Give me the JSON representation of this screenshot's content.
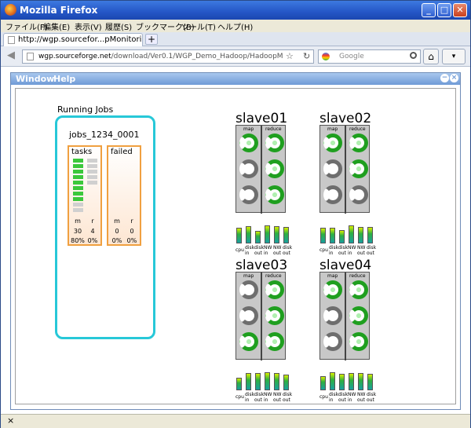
{
  "window": {
    "title": "Mozilla Firefox",
    "minimize": "_",
    "maximize": "□",
    "close": "✕"
  },
  "menu": [
    "ファイル(F)",
    "編集(E)",
    "表示(V)",
    "履歴(S)",
    "ブックマーク(B)",
    "ツール(T)",
    "ヘルプ(H)"
  ],
  "tab": {
    "label": "http://wgp.sourcefor...pMonitoringDemo.html",
    "new_tab": "+"
  },
  "nav": {
    "back": "◀",
    "forward": "▶",
    "url_host": "wgp.sourceforge.net",
    "url_path": "/download/Ver0.1/WGP_Demo_Hadoop/HadoopMonitoringDemo.h",
    "star": "☆",
    "reload": "↻",
    "search_placeholder": "Google",
    "home": "⌂"
  },
  "app": {
    "menu": [
      "Window",
      "Help"
    ]
  },
  "running_jobs": {
    "title": "Running Jobs",
    "job": "jobs_1234_0001",
    "tasks": {
      "header": "tasks",
      "col_m": "m",
      "col_r": "r",
      "m_count": "30",
      "r_count": "4",
      "m_pct": "80%",
      "r_pct": "0%",
      "m_fill": 0.8,
      "r_fill": 0
    },
    "failed": {
      "header": "failed",
      "col_m": "m",
      "col_r": "r",
      "m_count": "0",
      "r_count": "0",
      "m_pct": "0%",
      "r_pct": "0%"
    }
  },
  "nodes": [
    {
      "name": "slave01",
      "map": [
        1,
        0,
        0
      ],
      "reduce": [
        1,
        1,
        1
      ],
      "metrics": [
        0.75,
        0.85,
        0.6,
        0.9,
        0.85,
        0.8
      ]
    },
    {
      "name": "slave02",
      "map": [
        1,
        0,
        0
      ],
      "reduce": [
        1,
        1,
        0
      ],
      "metrics": [
        0.75,
        0.75,
        0.65,
        0.9,
        0.8,
        0.8
      ]
    },
    {
      "name": "slave03",
      "map": [
        0,
        0,
        1
      ],
      "reduce": [
        1,
        1,
        1
      ],
      "metrics": [
        0.6,
        0.85,
        0.85,
        0.9,
        0.85,
        0.75
      ]
    },
    {
      "name": "slave04",
      "map": [
        1,
        0,
        0
      ],
      "reduce": [
        1,
        1,
        1
      ],
      "metrics": [
        0.7,
        0.9,
        0.8,
        0.85,
        0.85,
        0.8
      ]
    }
  ],
  "node_labels": {
    "map": "map",
    "reduce": "reduce",
    "metric_top": [
      "",
      "disk",
      "disk",
      "NW",
      "NW",
      "disk"
    ],
    "metric_bottom": [
      "cpu",
      "in",
      "out",
      "in",
      "out",
      "out"
    ]
  },
  "statusbar": {
    "close": "×"
  }
}
